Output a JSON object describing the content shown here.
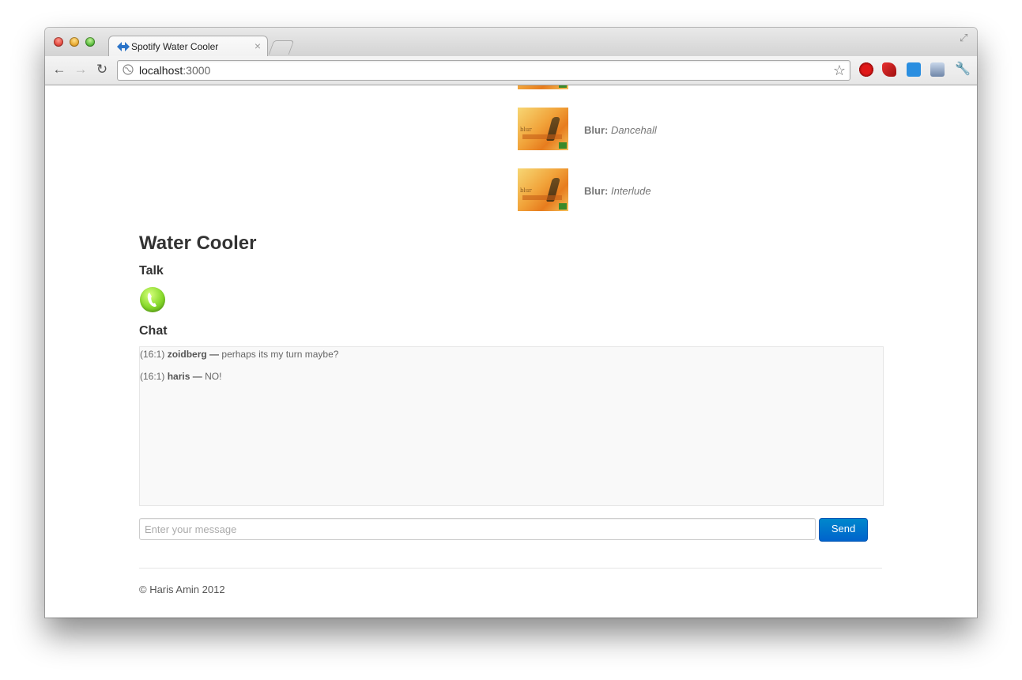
{
  "browser": {
    "tab_title": "Spotify Water Cooler",
    "url_host": "localhost",
    "url_port": ":3000"
  },
  "tracks": [
    {
      "artist": "Blur:",
      "title": "Dancehall"
    },
    {
      "artist": "Blur:",
      "title": "Interlude"
    }
  ],
  "album_art_label": "blur",
  "page": {
    "title": "Water Cooler",
    "talk_heading": "Talk",
    "chat_heading": "Chat"
  },
  "chat": {
    "messages": [
      {
        "time": "(16:1)",
        "user": "zoidberg —",
        "text": "perhaps its my turn maybe?"
      },
      {
        "time": "(16:1)",
        "user": "haris —",
        "text": "NO!"
      }
    ],
    "input_placeholder": "Enter your message",
    "send_label": "Send"
  },
  "footer": {
    "text": "© Haris Amin 2012"
  },
  "colors": {
    "send_button": "#0074cc",
    "talk_icon": "#86d82a"
  }
}
